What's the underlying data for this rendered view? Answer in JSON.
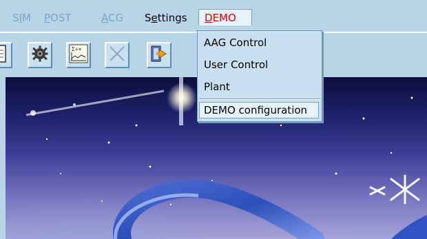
{
  "menubar": {
    "items": [
      {
        "label": "SIM",
        "mnemonic": "I",
        "enabled": false
      },
      {
        "label": "POST",
        "mnemonic": "P",
        "enabled": false
      },
      {
        "label": "ACG",
        "mnemonic": "A",
        "enabled": false
      },
      {
        "label": "Settings",
        "mnemonic": "e",
        "enabled": true
      },
      {
        "label": "DEMO",
        "mnemonic": "D",
        "enabled": true,
        "open": true
      }
    ]
  },
  "toolbar": {
    "buttons": [
      {
        "icon": "document-icon"
      },
      {
        "icon": "settings-gear-icon"
      },
      {
        "icon": "formula-chart-icon"
      },
      {
        "icon": "close-x-icon"
      },
      {
        "icon": "exit-door-icon"
      }
    ]
  },
  "demo_menu": {
    "items": [
      {
        "label": "AAG Control"
      },
      {
        "label": "User Control"
      },
      {
        "label": "Plant"
      },
      {
        "label": "DEMO configuration",
        "highlighted": true
      }
    ]
  },
  "colors": {
    "chrome": "#b8d4e6",
    "disabled_text": "#7aa7c7",
    "active_menu_text": "#e00000",
    "menu_background": "#c8e0ef"
  }
}
